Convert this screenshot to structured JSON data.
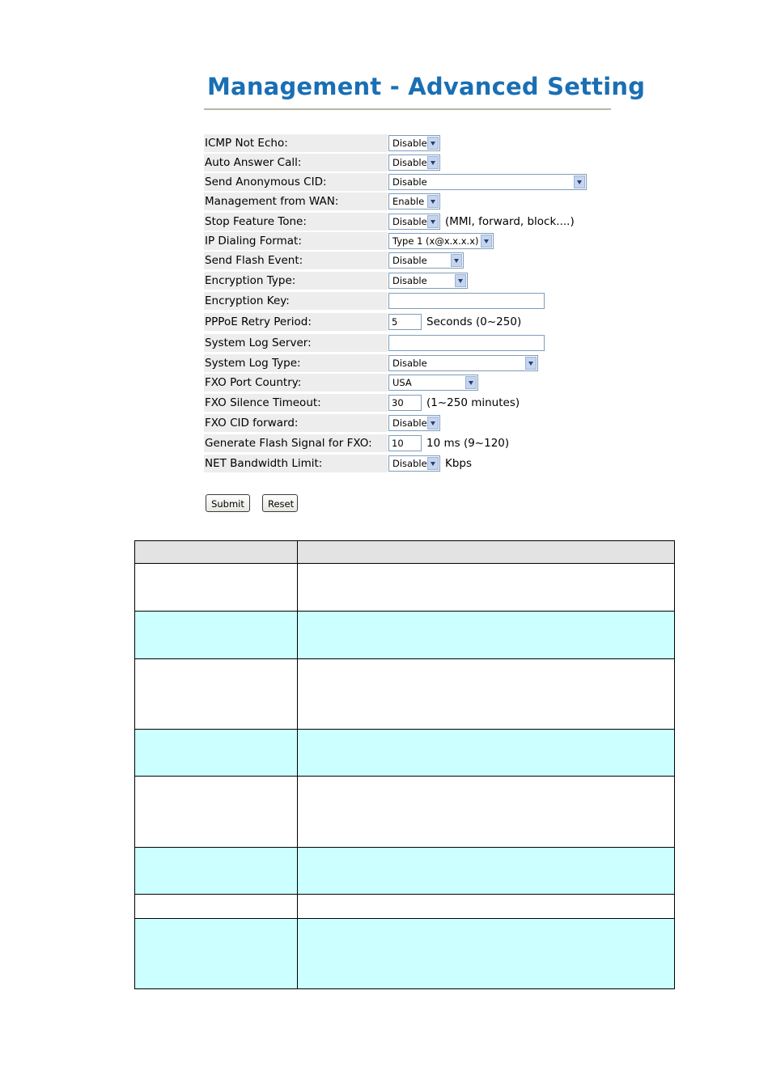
{
  "page": {
    "title": "Management - Advanced Setting"
  },
  "form": {
    "rows": [
      {
        "label": "ICMP Not Echo:",
        "value": "Disable"
      },
      {
        "label": "Auto Answer Call:",
        "value": "Disable"
      },
      {
        "label": "Send Anonymous CID:",
        "value": "Disable"
      },
      {
        "label": "Management from WAN:",
        "value": "Enable"
      },
      {
        "label": "Stop Feature Tone:",
        "value": "Disable",
        "suffix": "(MMI, forward, block....)"
      },
      {
        "label": "IP Dialing Format:",
        "value": "Type 1 (x@x.x.x.x)"
      },
      {
        "label": "Send Flash Event:",
        "value": "Disable"
      },
      {
        "label": "Encryption Type:",
        "value": "Disable"
      },
      {
        "label": "Encryption Key:",
        "value": ""
      },
      {
        "label": "PPPoE Retry Period:",
        "value": "5",
        "suffix": "Seconds (0~250)"
      },
      {
        "label": "System Log Server:",
        "value": ""
      },
      {
        "label": "System Log Type:",
        "value": "Disable"
      },
      {
        "label": "FXO Port Country:",
        "value": "USA"
      },
      {
        "label": "FXO Silence Timeout:",
        "value": "30",
        "suffix": "(1~250 minutes)"
      },
      {
        "label": "FXO CID forward:",
        "value": "Disable"
      },
      {
        "label": "Generate Flash Signal for FXO:",
        "value": "10",
        "suffix": "10 ms (9~120)"
      },
      {
        "label": "NET Bandwidth Limit:",
        "value": "Disable",
        "suffix": "Kbps"
      }
    ]
  },
  "buttons": {
    "submit": "Submit",
    "reset": "Reset"
  }
}
